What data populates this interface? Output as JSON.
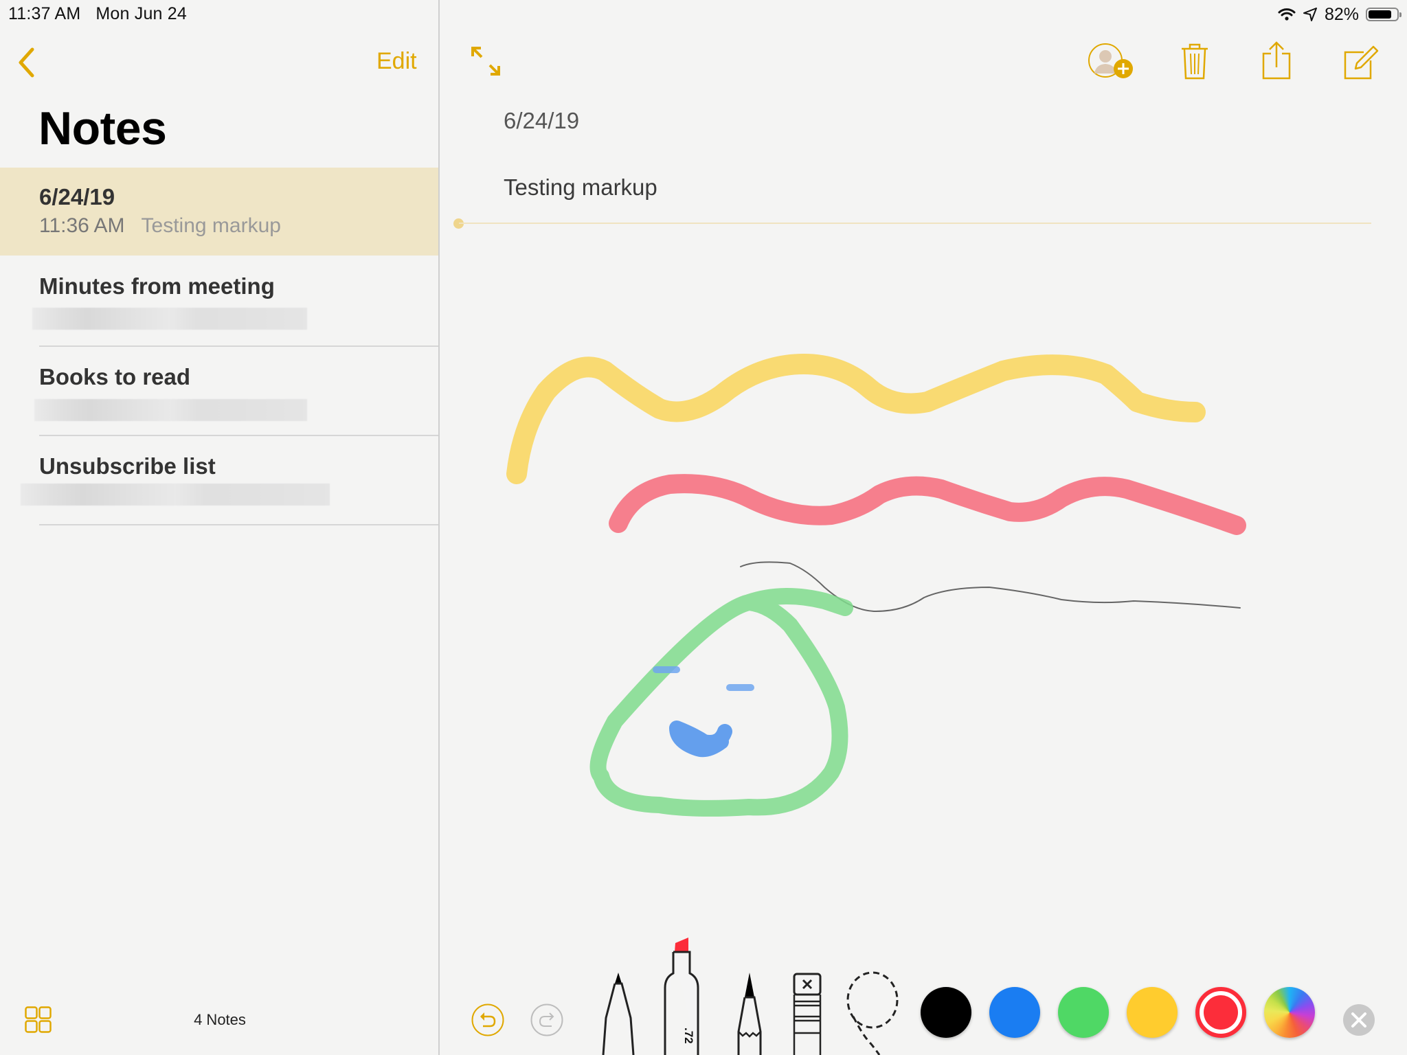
{
  "status_bar": {
    "time": "11:37 AM",
    "date": "Mon Jun 24",
    "battery_percent_label": "82%",
    "battery_level": 0.82,
    "icons": [
      "wifi-icon",
      "location-icon",
      "battery-icon"
    ]
  },
  "sidebar": {
    "back_icon": "chevron-left-icon",
    "edit_label": "Edit",
    "title": "Notes",
    "notes": [
      {
        "title": "6/24/19",
        "time": "11:36 AM",
        "preview": "Testing markup",
        "selected": true
      },
      {
        "title": "Minutes from meeting",
        "preview_redacted": true
      },
      {
        "title": "Books to read",
        "preview_redacted": true
      },
      {
        "title": "Unsubscribe list",
        "preview_redacted": true
      }
    ],
    "footer": {
      "gallery_icon": "grid-icon",
      "count_label": "4 Notes"
    }
  },
  "toolbar": {
    "expand_icon": "expand-icon",
    "add_people_icon": "add-person-icon",
    "trash_icon": "trash-icon",
    "share_icon": "share-icon",
    "compose_icon": "compose-icon"
  },
  "note": {
    "date": "6/24/19",
    "body": "Testing markup",
    "drawing": {
      "strokes": [
        {
          "name": "yellow-wave-stroke",
          "color": "#f9d55a",
          "tool": "marker"
        },
        {
          "name": "red-wave-stroke",
          "color": "#f66a7a",
          "tool": "marker"
        },
        {
          "name": "pencil-wave-stroke",
          "color": "#555555",
          "tool": "pencil"
        },
        {
          "name": "green-circle-stroke",
          "color": "#7fda8c",
          "tool": "marker"
        },
        {
          "name": "blue-left-eye-stroke",
          "color": "#6ea6ee",
          "tool": "marker"
        },
        {
          "name": "blue-right-eye-stroke",
          "color": "#6ea6ee",
          "tool": "marker"
        },
        {
          "name": "blue-mouth-stroke",
          "color": "#5496ec",
          "tool": "marker"
        }
      ]
    }
  },
  "markup_tools": {
    "undo_icon": "undo-icon",
    "redo_icon": "redo-icon",
    "tools": [
      {
        "name": "pen-tool",
        "label": ""
      },
      {
        "name": "marker-tool",
        "label": ".72",
        "tip_color": "#fc2d3a"
      },
      {
        "name": "pencil-tool",
        "label": ""
      },
      {
        "name": "eraser-tool",
        "label": "×"
      },
      {
        "name": "lasso-tool",
        "label": ""
      }
    ],
    "colors": [
      {
        "name": "black",
        "hex": "#000000"
      },
      {
        "name": "blue",
        "hex": "#1a7df2"
      },
      {
        "name": "green",
        "hex": "#4fd865"
      },
      {
        "name": "yellow",
        "hex": "#ffcc2e"
      },
      {
        "name": "red",
        "hex": "#fc2d3a",
        "selected": true
      },
      {
        "name": "color-wheel",
        "hex": ""
      }
    ],
    "close_icon": "close-icon"
  },
  "accent_color": "#e0a800"
}
